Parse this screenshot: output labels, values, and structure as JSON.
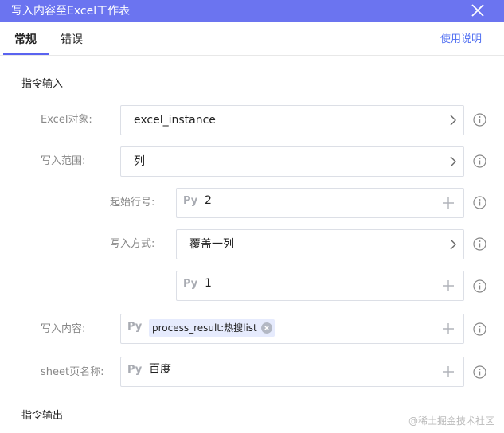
{
  "dialog": {
    "title": "写入内容至Excel工作表",
    "close_icon": "close-icon"
  },
  "tabs": [
    {
      "label": "常规",
      "active": true
    },
    {
      "label": "错误",
      "active": false
    }
  ],
  "help_link": "使用说明",
  "sections": {
    "input_title": "指令输入",
    "output_title": "指令输出"
  },
  "fields": {
    "excel_object": {
      "label": "Excel对象:",
      "value": "excel_instance"
    },
    "write_range": {
      "label": "写入范围:",
      "value": "列"
    },
    "start_row": {
      "label": "起始行号:",
      "prefix": "Py",
      "value": "2"
    },
    "write_mode": {
      "label": "写入方式:",
      "value": "覆盖一列"
    },
    "column_index": {
      "prefix": "Py",
      "value": "1"
    },
    "write_content": {
      "label": "写入内容:",
      "prefix": "Py",
      "tag": "process_result:热搜list"
    },
    "sheet_name": {
      "label": "sheet页名称:",
      "prefix": "Py",
      "value": "百度"
    }
  },
  "watermark": "@稀土掘金技术社区",
  "colors": {
    "titlebar": "#6b74f0",
    "accent": "#5a63f0",
    "link": "#4f6ef2",
    "tag_bg": "#e6ebfd"
  }
}
